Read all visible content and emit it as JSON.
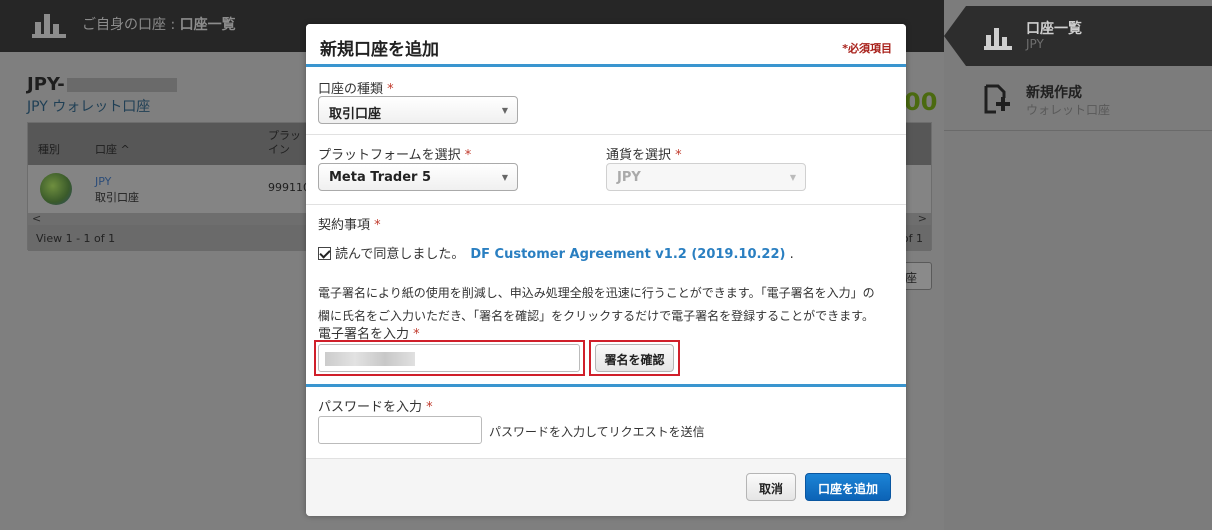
{
  "topbar": {
    "crumb_prefix": "ご自身の口座 : ",
    "crumb_current": "口座一覧"
  },
  "account": {
    "title": "JPY-",
    "subtitle": "JPY ウォレット口座",
    "balance_fragment": "00"
  },
  "grid": {
    "columns": [
      "種別",
      "口座 ^",
      "プラッ",
      "イン"
    ],
    "row": {
      "link": "JPY",
      "type": "取引口座",
      "number": "999110"
    },
    "footer_left": "View 1 - 1 of 1",
    "footer_right": "of 1",
    "scroll_left": "<",
    "scroll_right": ">"
  },
  "background_button": "座",
  "right_panel": {
    "items": [
      {
        "title": "口座一覧",
        "subtitle": "JPY"
      },
      {
        "title": "新規作成",
        "subtitle": "ウォレット口座"
      }
    ]
  },
  "modal": {
    "title": "新規口座を追加",
    "required_note": "*必須項目",
    "account_type": {
      "label": "口座の種類",
      "value": "取引口座"
    },
    "platform": {
      "label": "プラットフォームを選択",
      "value": "Meta Trader 5"
    },
    "currency": {
      "label": "通貨を選択",
      "value": "JPY"
    },
    "contract": {
      "label": "契約事項",
      "agree_text": "読んで同意しました。",
      "link_text": "DF Customer Agreement v1.2 (2019.10.22)",
      "suffix": "."
    },
    "description_line1": "電子署名により紙の使用を削減し、申込み処理全般を迅速に行うことができます。「電子署名を入力」の",
    "description_line2": "欄に氏名をご入力いただき、「署名を確認」をクリックするだけで電子署名を登録することができます。",
    "signature": {
      "label": "電子署名を入力",
      "confirm_button": "署名を確認"
    },
    "password": {
      "label": "パスワードを入力",
      "hint": "パスワードを入力してリクエストを送信"
    },
    "cancel_button": "取消",
    "submit_button": "口座を追加",
    "required_star": "*"
  },
  "colors": {
    "accent": "#3a95cf",
    "primary_button": "#0c63b6",
    "highlight": "#d01f2a",
    "required": "#a8201a"
  }
}
